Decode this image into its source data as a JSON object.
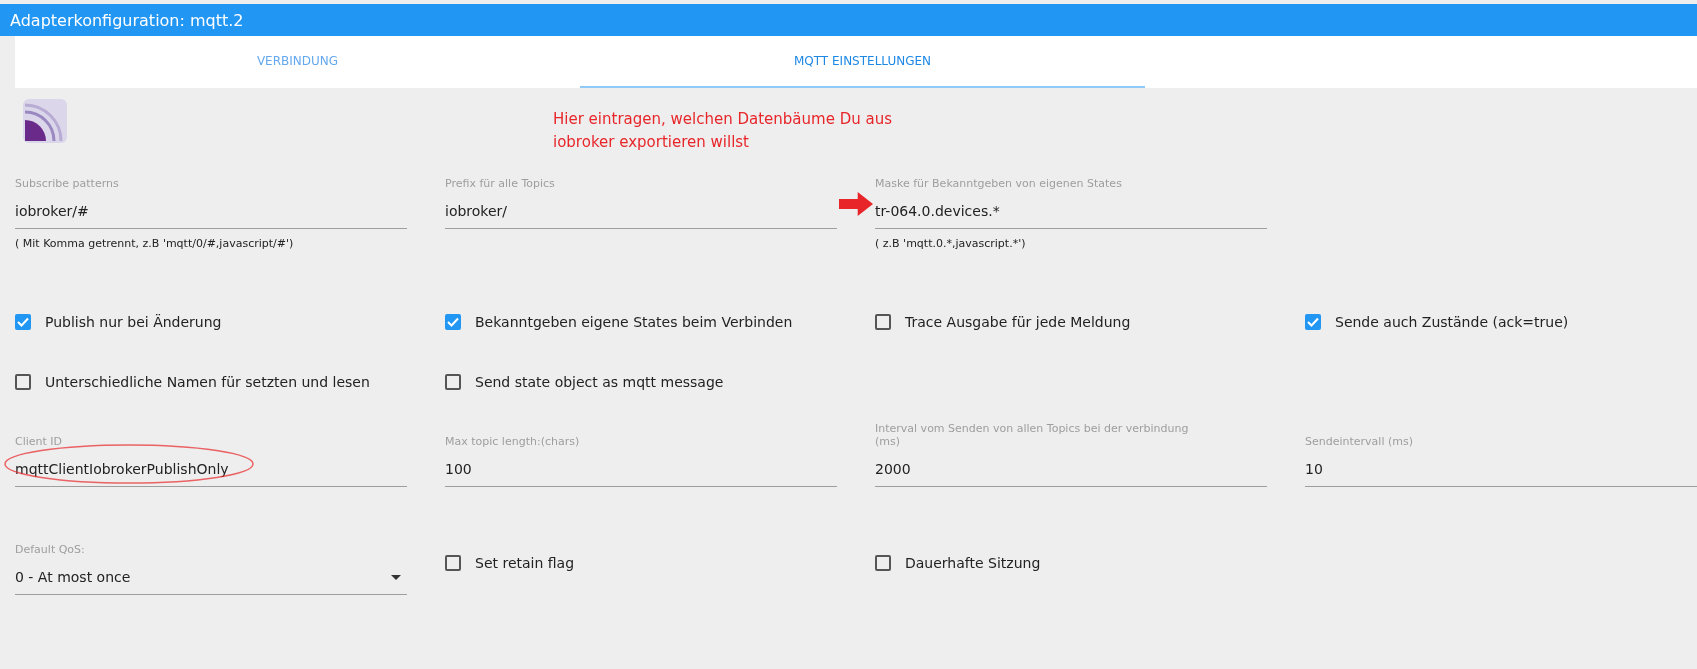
{
  "window": {
    "title": "Adapterkonfiguration: mqtt.2"
  },
  "tabs": [
    {
      "label": "VERBINDUNG",
      "selected": false
    },
    {
      "label": "MQTT EINSTELLUNGEN",
      "selected": true
    }
  ],
  "annotation": {
    "text": "Hier eintragen, welchen Datenbäume Du aus iobroker exportieren willst"
  },
  "rows": [
    {
      "kind": "fields",
      "items": [
        {
          "kind": "text",
          "label": "Subscribe patterns",
          "value": "iobroker/#",
          "helper": "( Mit Komma getrennt, z.B 'mqtt/0/#,javascript/#')"
        },
        {
          "kind": "text",
          "label": "Prefix für alle Topics",
          "value": "iobroker/"
        },
        {
          "kind": "text",
          "label": "Maske für Bekanntgeben von eigenen States",
          "value": "tr-064.0.devices.*",
          "helper": "( z.B 'mqtt.0.*,javascript.*')",
          "annotation": {
            "kind": "arrow"
          }
        }
      ]
    },
    {
      "kind": "checks",
      "items": [
        {
          "kind": "checkbox",
          "label": "Publish nur bei Änderung",
          "checked": true
        },
        {
          "kind": "checkbox",
          "label": "Bekanntgeben eigene States beim Verbinden",
          "checked": true
        },
        {
          "kind": "checkbox",
          "label": "Trace Ausgabe für jede Meldung",
          "checked": false
        },
        {
          "kind": "checkbox",
          "label": "Sende auch Zustände (ack=true)",
          "checked": true
        }
      ]
    },
    {
      "kind": "checks",
      "items": [
        {
          "kind": "checkbox",
          "label": "Unterschiedliche Namen für setzten und lesen",
          "checked": false
        },
        {
          "kind": "checkbox",
          "label": "Send state object as mqtt message",
          "checked": false
        }
      ]
    },
    {
      "kind": "fields",
      "items": [
        {
          "kind": "text",
          "label": "Client ID",
          "value": "mqttClientIobrokerPublishOnly",
          "annotation": {
            "kind": "ellipse"
          }
        },
        {
          "kind": "text",
          "label": "Max topic length:(chars)",
          "value": "100"
        },
        {
          "kind": "text",
          "label": "Interval vom Senden von allen Topics bei der verbindung (ms)",
          "value": "2000"
        },
        {
          "kind": "text",
          "label": "Sendeintervall (ms)",
          "value": "10"
        }
      ]
    },
    {
      "kind": "mixed",
      "items": [
        {
          "kind": "select",
          "label": "Default QoS:",
          "value": "0 - At most once"
        },
        {
          "kind": "checkbox",
          "label": "Set retain flag",
          "checked": false
        },
        {
          "kind": "checkbox",
          "label": "Dauerhafte Sitzung",
          "checked": false
        }
      ]
    }
  ]
}
